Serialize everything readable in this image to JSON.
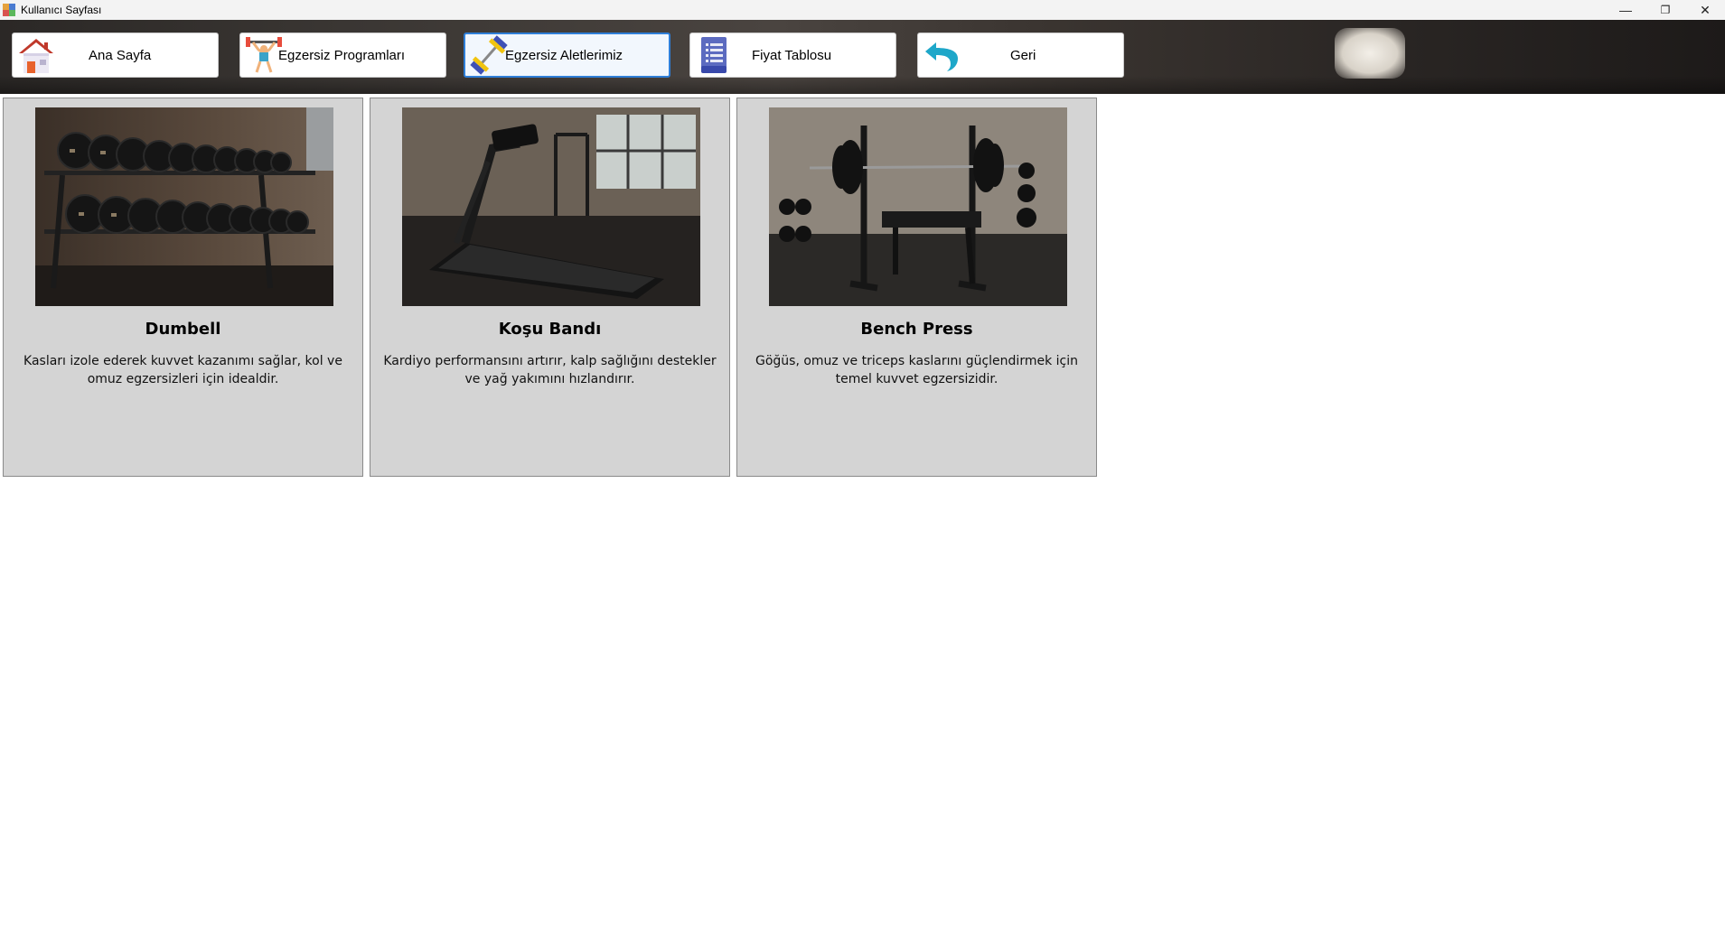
{
  "window": {
    "title": "Kullanıcı Sayfası",
    "controls": {
      "minimize": "—",
      "restore": "❐",
      "close": "✕"
    }
  },
  "toolbar": {
    "buttons": [
      {
        "label": "Ana Sayfa",
        "icon": "home-icon",
        "active": false
      },
      {
        "label": "Egzersiz Programları",
        "icon": "weightlifter-icon",
        "active": false
      },
      {
        "label": "Egzersiz Aletlerimiz",
        "icon": "dumbbell-icon",
        "active": true
      },
      {
        "label": "Fiyat Tablosu",
        "icon": "document-list-icon",
        "active": false
      },
      {
        "label": "Geri",
        "icon": "back-arrow-icon",
        "active": false
      }
    ]
  },
  "equipment": [
    {
      "name": "Dumbell",
      "description": "Kasları izole ederek kuvvet kazanımı sağlar, kol ve omuz egzersizleri için idealdir."
    },
    {
      "name": "Koşu Bandı",
      "description": "Kardiyo performansını artırır, kalp sağlığını destekler ve yağ yakımını hızlandırır."
    },
    {
      "name": "Bench Press",
      "description": "Göğüs, omuz ve triceps kaslarını güçlendirmek için temel kuvvet egzersizidir."
    }
  ],
  "colors": {
    "active_border": "#2f7fd8",
    "card_background": "#d4d4d4"
  }
}
